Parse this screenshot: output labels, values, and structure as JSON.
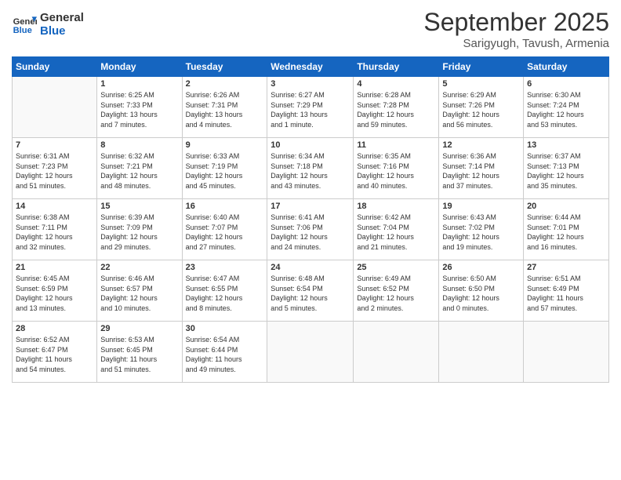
{
  "header": {
    "logo_line1": "General",
    "logo_line2": "Blue",
    "month": "September 2025",
    "location": "Sarigyugh, Tavush, Armenia"
  },
  "weekdays": [
    "Sunday",
    "Monday",
    "Tuesday",
    "Wednesday",
    "Thursday",
    "Friday",
    "Saturday"
  ],
  "weeks": [
    [
      {
        "day": "",
        "info": ""
      },
      {
        "day": "1",
        "info": "Sunrise: 6:25 AM\nSunset: 7:33 PM\nDaylight: 13 hours\nand 7 minutes."
      },
      {
        "day": "2",
        "info": "Sunrise: 6:26 AM\nSunset: 7:31 PM\nDaylight: 13 hours\nand 4 minutes."
      },
      {
        "day": "3",
        "info": "Sunrise: 6:27 AM\nSunset: 7:29 PM\nDaylight: 13 hours\nand 1 minute."
      },
      {
        "day": "4",
        "info": "Sunrise: 6:28 AM\nSunset: 7:28 PM\nDaylight: 12 hours\nand 59 minutes."
      },
      {
        "day": "5",
        "info": "Sunrise: 6:29 AM\nSunset: 7:26 PM\nDaylight: 12 hours\nand 56 minutes."
      },
      {
        "day": "6",
        "info": "Sunrise: 6:30 AM\nSunset: 7:24 PM\nDaylight: 12 hours\nand 53 minutes."
      }
    ],
    [
      {
        "day": "7",
        "info": "Sunrise: 6:31 AM\nSunset: 7:23 PM\nDaylight: 12 hours\nand 51 minutes."
      },
      {
        "day": "8",
        "info": "Sunrise: 6:32 AM\nSunset: 7:21 PM\nDaylight: 12 hours\nand 48 minutes."
      },
      {
        "day": "9",
        "info": "Sunrise: 6:33 AM\nSunset: 7:19 PM\nDaylight: 12 hours\nand 45 minutes."
      },
      {
        "day": "10",
        "info": "Sunrise: 6:34 AM\nSunset: 7:18 PM\nDaylight: 12 hours\nand 43 minutes."
      },
      {
        "day": "11",
        "info": "Sunrise: 6:35 AM\nSunset: 7:16 PM\nDaylight: 12 hours\nand 40 minutes."
      },
      {
        "day": "12",
        "info": "Sunrise: 6:36 AM\nSunset: 7:14 PM\nDaylight: 12 hours\nand 37 minutes."
      },
      {
        "day": "13",
        "info": "Sunrise: 6:37 AM\nSunset: 7:13 PM\nDaylight: 12 hours\nand 35 minutes."
      }
    ],
    [
      {
        "day": "14",
        "info": "Sunrise: 6:38 AM\nSunset: 7:11 PM\nDaylight: 12 hours\nand 32 minutes."
      },
      {
        "day": "15",
        "info": "Sunrise: 6:39 AM\nSunset: 7:09 PM\nDaylight: 12 hours\nand 29 minutes."
      },
      {
        "day": "16",
        "info": "Sunrise: 6:40 AM\nSunset: 7:07 PM\nDaylight: 12 hours\nand 27 minutes."
      },
      {
        "day": "17",
        "info": "Sunrise: 6:41 AM\nSunset: 7:06 PM\nDaylight: 12 hours\nand 24 minutes."
      },
      {
        "day": "18",
        "info": "Sunrise: 6:42 AM\nSunset: 7:04 PM\nDaylight: 12 hours\nand 21 minutes."
      },
      {
        "day": "19",
        "info": "Sunrise: 6:43 AM\nSunset: 7:02 PM\nDaylight: 12 hours\nand 19 minutes."
      },
      {
        "day": "20",
        "info": "Sunrise: 6:44 AM\nSunset: 7:01 PM\nDaylight: 12 hours\nand 16 minutes."
      }
    ],
    [
      {
        "day": "21",
        "info": "Sunrise: 6:45 AM\nSunset: 6:59 PM\nDaylight: 12 hours\nand 13 minutes."
      },
      {
        "day": "22",
        "info": "Sunrise: 6:46 AM\nSunset: 6:57 PM\nDaylight: 12 hours\nand 10 minutes."
      },
      {
        "day": "23",
        "info": "Sunrise: 6:47 AM\nSunset: 6:55 PM\nDaylight: 12 hours\nand 8 minutes."
      },
      {
        "day": "24",
        "info": "Sunrise: 6:48 AM\nSunset: 6:54 PM\nDaylight: 12 hours\nand 5 minutes."
      },
      {
        "day": "25",
        "info": "Sunrise: 6:49 AM\nSunset: 6:52 PM\nDaylight: 12 hours\nand 2 minutes."
      },
      {
        "day": "26",
        "info": "Sunrise: 6:50 AM\nSunset: 6:50 PM\nDaylight: 12 hours\nand 0 minutes."
      },
      {
        "day": "27",
        "info": "Sunrise: 6:51 AM\nSunset: 6:49 PM\nDaylight: 11 hours\nand 57 minutes."
      }
    ],
    [
      {
        "day": "28",
        "info": "Sunrise: 6:52 AM\nSunset: 6:47 PM\nDaylight: 11 hours\nand 54 minutes."
      },
      {
        "day": "29",
        "info": "Sunrise: 6:53 AM\nSunset: 6:45 PM\nDaylight: 11 hours\nand 51 minutes."
      },
      {
        "day": "30",
        "info": "Sunrise: 6:54 AM\nSunset: 6:44 PM\nDaylight: 11 hours\nand 49 minutes."
      },
      {
        "day": "",
        "info": ""
      },
      {
        "day": "",
        "info": ""
      },
      {
        "day": "",
        "info": ""
      },
      {
        "day": "",
        "info": ""
      }
    ]
  ]
}
